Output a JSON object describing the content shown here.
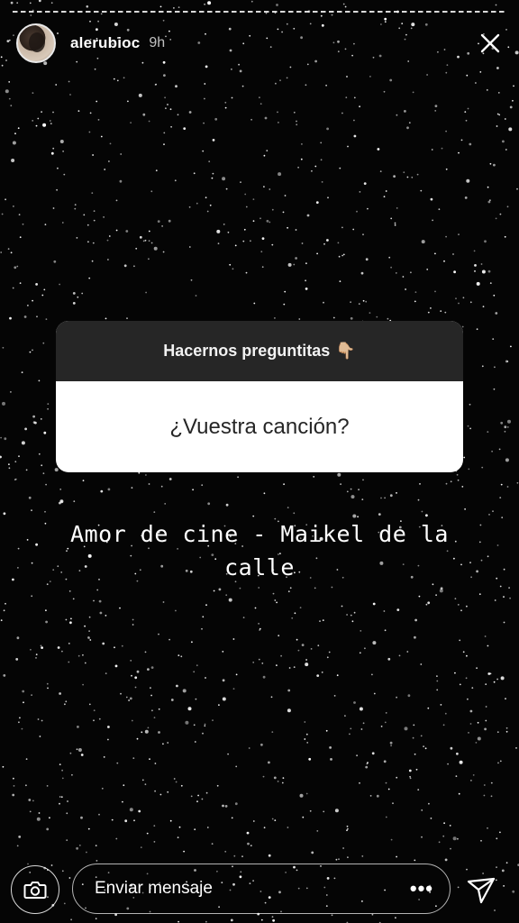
{
  "story": {
    "username": "alerubioc",
    "time_ago": "9h"
  },
  "question_sticker": {
    "header": "Hacernos preguntitas",
    "header_emoji": "👇🏼",
    "question": "¿Vuestra canción?"
  },
  "answer_text": {
    "line1": "Amor de cine - Maikel de la",
    "line2": "calle"
  },
  "reply_bar": {
    "placeholder": "Enviar mensaje",
    "more": "•••"
  },
  "icons": {
    "close": "close-icon",
    "camera": "camera-icon",
    "send": "send-icon",
    "more": "more-icon"
  },
  "colors": {
    "background": "#050505",
    "sticker_header_bg": "#262626",
    "sticker_body_bg": "#ffffff",
    "text": "#ffffff"
  }
}
